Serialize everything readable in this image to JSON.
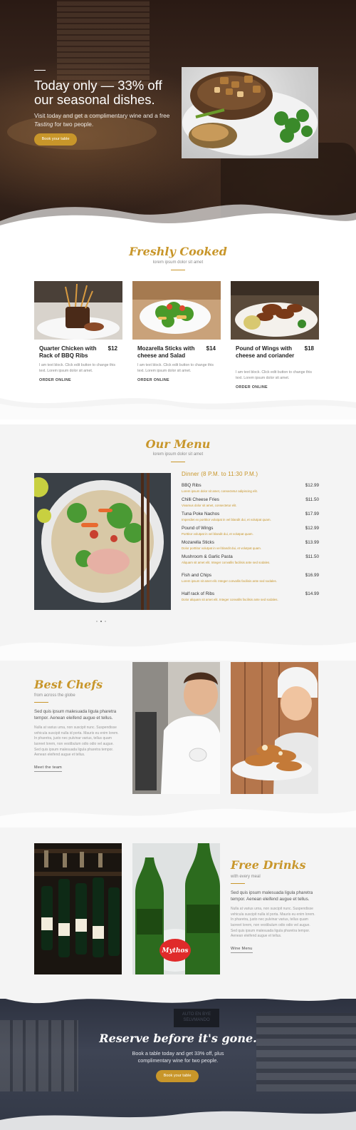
{
  "hero": {
    "title": "Today only — 33% off our seasonal dishes.",
    "subtitle_pre": "Visit today and get a complimentary wine and a free ",
    "subtitle_em": "Tasting",
    "subtitle_post": " for two people.",
    "button": "Book your table"
  },
  "fresh": {
    "title": "Freshly Cooked",
    "tagline": "lorem ipsum dolor sit amet",
    "cards": [
      {
        "name": "Quarter Chicken with Rack of BBQ Ribs",
        "price": "$12",
        "desc": "I am text block. Click edit button to change this text. Lorem ipsum dolor sit amet.",
        "link": "ORDER ONLINE"
      },
      {
        "name": "Mozarella Sticks with cheese and Salad",
        "price": "$14",
        "desc": "I am text block. Click edit button to change this text. Lorem ipsum dolor sit amet.",
        "link": "ORDER ONLINE"
      },
      {
        "name": "Pound of Wings with cheese and coriander",
        "price": "$18",
        "desc": "I am text block. Click edit button to change this text. Lorem ipsum dolor sit amet.",
        "link": "ORDER ONLINE"
      }
    ]
  },
  "menu": {
    "title": "Our Menu",
    "tagline": "lorem ipsum dolor sit amet",
    "heading": "Dinner (8 P.M. to 11:30 P.M.)",
    "items": [
      {
        "name": "BBQ Ribs",
        "price": "$12.99",
        "desc": "Lorem ipsum dolor sit amet, consectetur adipiscing elit."
      },
      {
        "name": "Chilli Cheese Fries",
        "price": "$11.50",
        "desc": "Vivamus dolor sit amet, consectetur elit."
      },
      {
        "name": "Tuna Poke Nachos",
        "price": "$17.99",
        "desc": "Imperdiet ex porttitor volutpat in vel blandit dui, et volutpat quam."
      },
      {
        "name": "Pound of Wings",
        "price": "$12.99",
        "desc": "Porttitor volutpat in vel blandit dui, et volutpat quam."
      },
      {
        "name": "Mozarella Sticks",
        "price": "$13.99",
        "desc": "Dolor porttitor volutpat in vel blandit dui, et volutpat quam."
      },
      {
        "name": "Mushroom & Garlic Pasta",
        "price": "$11.50",
        "desc": "Aliquam sit amet elit. Integer convallis facilisis ante sed sodales."
      },
      {
        "name": "Fish and Chips",
        "price": "$16.99",
        "desc": "Lorem ipsum sit amet elit. Integer convallis facilisis ante sed sodales."
      },
      {
        "name": "Half rack of Ribs",
        "price": "$14.99",
        "desc": "Dolor aliquam sit amet elit. Integer convallis facilisis ante sed sodales."
      }
    ]
  },
  "chefs": {
    "title": "Best Chefs",
    "subtitle": "from across the globe",
    "lead": "Sed quis ipsum malesuada ligula pharetra tempor. Aenean eleifend augue et tellus.",
    "body": "Nulla at varius urna, non suscipit nunc. Suspendisse vehicula suscipit nulla id porta. Mauris eu enim lorem. In pharetra, justo nec pulvinar varius, tellus quam laoreet lorem, non vestibulum odio odio vel augue. Sed quis ipsum malesuada ligula pharetra tempor. Aenean eleifend augue et tellus.",
    "link": "Meet the team"
  },
  "drinks": {
    "title": "Free Drinks",
    "subtitle": "with every meal",
    "lead": "Sed quis ipsum malesuada ligula pharetra tempor. Aenean eleifend augue et tellus.",
    "body": "Nulla at varius urna, non suscipit nunc. Suspendisse vehicula suscipit nulla id porta. Mauris eu enim lorem. In pharetra, justo nec pulvinar varius, tellus quam laoreet lorem, non vestibulum odio odio vel augue. Sed quis ipsum malesuada ligula pharetra tempor. Aenean eleifend augue et tellus.",
    "link": "Wine Menu",
    "bottle_label": "Mythos"
  },
  "reserve": {
    "title": "Reserve before it's gone.",
    "subtitle": "Book a table today and get 33% off, plus complimentary wine for two people.",
    "button": "Book your table",
    "sign_text": "AUTO EN BYE SELVMANDO"
  },
  "colors": {
    "accent": "#c8962a",
    "dark": "#2a1a14",
    "bg": "#f4f4f4"
  }
}
